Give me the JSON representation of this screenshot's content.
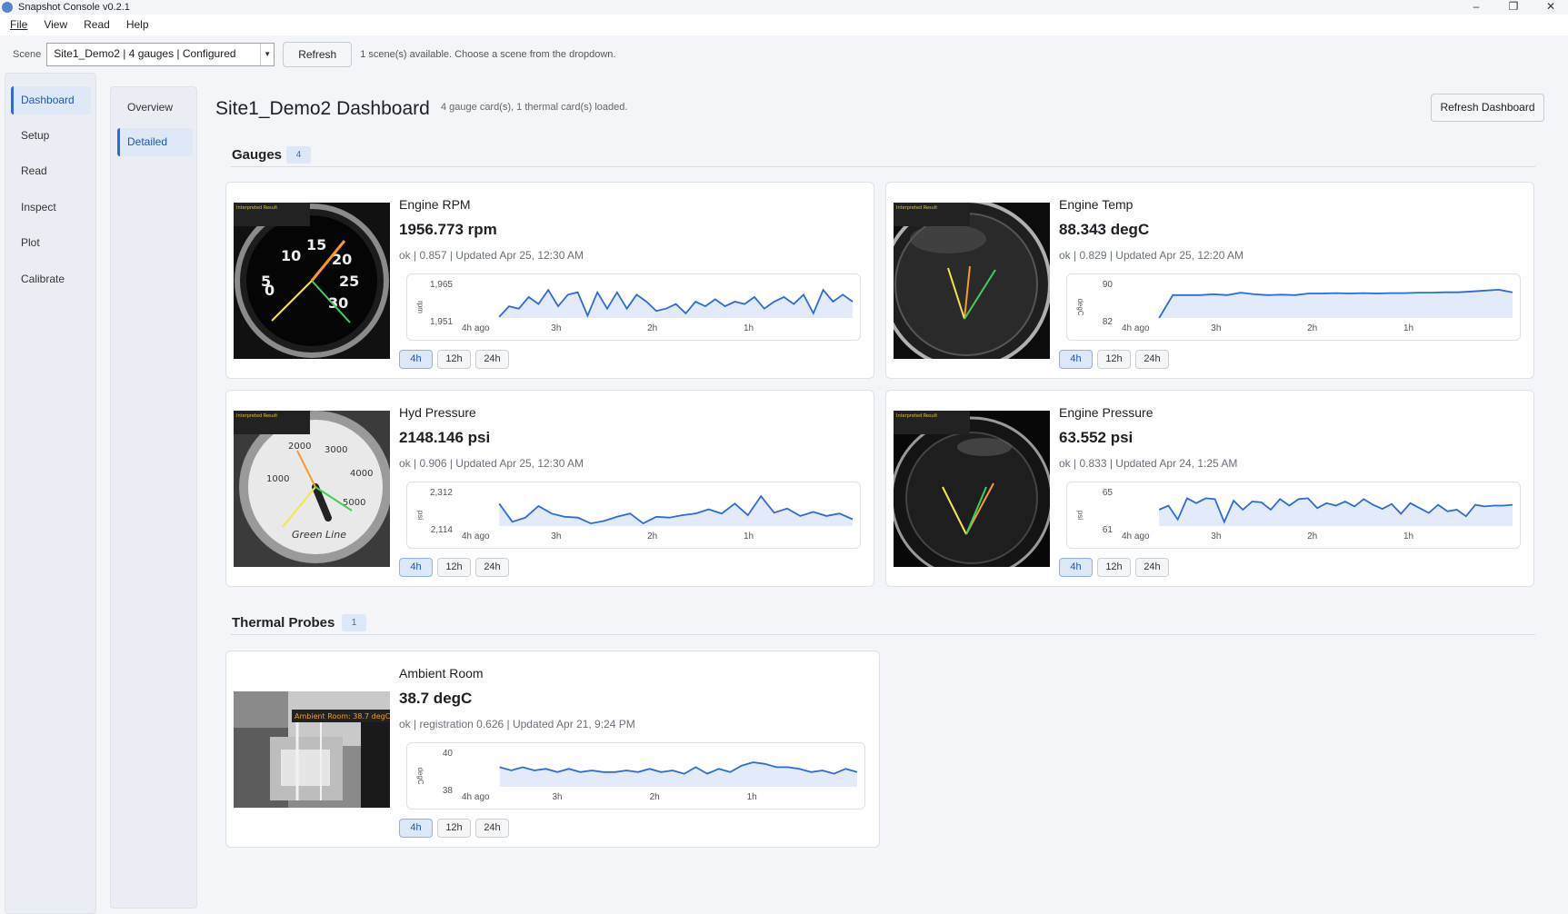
{
  "window": {
    "title": "Snapshot Console v0.2.1",
    "controls": {
      "minimize": "–",
      "maximize": "❐",
      "close": "✕"
    }
  },
  "menu": [
    "File",
    "View",
    "Read",
    "Help"
  ],
  "scene": {
    "label": "Scene",
    "selected": "Site1_Demo2 | 4 gauges | Configured",
    "refresh_label": "Refresh",
    "status": "1 scene(s) available. Choose a scene from the dropdown."
  },
  "nav": {
    "items": [
      "Dashboard",
      "Setup",
      "Read",
      "Inspect",
      "Plot",
      "Calibrate"
    ],
    "active": "Dashboard"
  },
  "subnav": {
    "items": [
      "Overview",
      "Detailed"
    ],
    "active": "Detailed"
  },
  "header": {
    "title": "Site1_Demo2 Dashboard",
    "subtitle": "4 gauge card(s), 1 thermal card(s) loaded.",
    "refresh_label": "Refresh Dashboard"
  },
  "sections": {
    "gauges": {
      "title": "Gauges",
      "count": "4"
    },
    "thermal": {
      "title": "Thermal Probes",
      "count": "1"
    }
  },
  "colors": {
    "accent": "#2f6bd6",
    "spark_fill": "#e3ebfa",
    "needle_orange": "#f39c2b",
    "needle_green": "#3fd15a",
    "needle_yellow": "#f5e54b"
  },
  "range_options": [
    "4h",
    "12h",
    "24h"
  ],
  "active_range": "4h",
  "cards": [
    {
      "id": "engine-rpm",
      "title": "Engine RPM",
      "value": "1956.773 rpm",
      "meta": "ok | 0.857 | Updated Apr 25, 12:30 AM",
      "thumb": {
        "type": "gauge-dark",
        "dial_labels": [
          "0",
          "5",
          "10",
          "15",
          "20",
          "25",
          "30"
        ],
        "caption": "Interpreted Result"
      },
      "chart_data": {
        "type": "line",
        "ylabel": "rpm",
        "y_ticks": [
          "1,965",
          "1,951"
        ],
        "ylim": [
          1951,
          1965
        ],
        "x_ticks": [
          "4h ago",
          "3h",
          "2h",
          "1h"
        ],
        "values": [
          1951.5,
          1956,
          1955,
          1960,
          1957,
          1963,
          1956,
          1961,
          1962,
          1952,
          1962,
          1955,
          1962,
          1955,
          1961,
          1958,
          1954,
          1955,
          1957,
          1953,
          1958,
          1956,
          1959,
          1956,
          1958,
          1957,
          1960,
          1955,
          1958,
          1960,
          1957,
          1961,
          1953,
          1963,
          1958,
          1961,
          1958
        ]
      }
    },
    {
      "id": "engine-temp",
      "title": "Engine Temp",
      "value": "88.343 degC",
      "meta": "ok | 0.829 | Updated Apr 25, 12:20 AM",
      "thumb": {
        "type": "gauge-glass",
        "caption": "Interpreted Result"
      },
      "chart_data": {
        "type": "line",
        "ylabel": "degC",
        "y_ticks": [
          "90",
          "82"
        ],
        "ylim": [
          82,
          90
        ],
        "x_ticks": [
          "4h ago",
          "3h",
          "2h",
          "1h"
        ],
        "values": [
          82,
          87.6,
          87.6,
          87.6,
          87.8,
          87.6,
          88.2,
          87.8,
          87.6,
          87.7,
          87.6,
          88.0,
          88.0,
          88.1,
          88.0,
          88.1,
          88.0,
          88.1,
          88.1,
          88.2,
          88.2,
          88.3,
          88.3,
          88.5,
          88.7,
          88.9,
          88.3
        ]
      }
    },
    {
      "id": "hyd-pressure",
      "title": "Hyd Pressure",
      "value": "2148.146 psi",
      "meta": "ok | 0.906 | Updated Apr 25, 12:30 AM",
      "thumb": {
        "type": "gauge-white",
        "dial_labels": [
          "1000",
          "2000",
          "3000",
          "4000",
          "5000"
        ],
        "brand": "Green Line",
        "caption": "Interpreted Result"
      },
      "chart_data": {
        "type": "line",
        "ylabel": "psi",
        "y_ticks": [
          "2,312",
          "2,114"
        ],
        "ylim": [
          2114,
          2312
        ],
        "x_ticks": [
          "4h ago",
          "3h",
          "2h",
          "1h"
        ],
        "values": [
          2250,
          2140,
          2165,
          2235,
          2190,
          2170,
          2165,
          2130,
          2145,
          2170,
          2190,
          2130,
          2170,
          2165,
          2180,
          2190,
          2215,
          2190,
          2250,
          2180,
          2295,
          2195,
          2220,
          2175,
          2200,
          2175,
          2190,
          2155
        ]
      }
    },
    {
      "id": "engine-pressure",
      "title": "Engine Pressure",
      "value": "63.552 psi",
      "meta": "ok | 0.833 | Updated Apr 24, 1:25 AM",
      "thumb": {
        "type": "gauge-dark-glass",
        "caption": "Interpreted Result"
      },
      "chart_data": {
        "type": "line",
        "ylabel": "psi",
        "y_ticks": [
          "65",
          "61"
        ],
        "ylim": [
          61,
          65
        ],
        "x_ticks": [
          "4h ago",
          "3h",
          "2h",
          "1h"
        ],
        "values": [
          63.0,
          63.5,
          61.8,
          64.4,
          63.8,
          64.4,
          64.3,
          61.5,
          64.1,
          63.0,
          64.0,
          63.9,
          63.0,
          64.3,
          63.5,
          64.3,
          64.4,
          63.2,
          63.8,
          63.5,
          64.0,
          63.4,
          64.3,
          63.6,
          63.1,
          63.7,
          62.5,
          63.8,
          63.2,
          62.6,
          63.6,
          62.8,
          63.0,
          62.2,
          63.6,
          63.4,
          63.5,
          63.5,
          63.6
        ]
      }
    },
    {
      "id": "ambient-room",
      "title": "Ambient Room",
      "value": "38.7 degC",
      "meta": "ok | registration 0.626 | Updated Apr 21, 9:24 PM",
      "thumb": {
        "type": "thermal",
        "caption": "Ambient Room: 38.7 degC"
      },
      "chart_data": {
        "type": "line",
        "ylabel": "degC",
        "y_ticks": [
          "40",
          "38"
        ],
        "ylim": [
          38,
          40
        ],
        "x_ticks": [
          "4h ago",
          "3h",
          "2h",
          "1h"
        ],
        "values": [
          39.2,
          39.0,
          39.2,
          39.0,
          39.1,
          38.9,
          39.1,
          38.9,
          39.0,
          38.9,
          38.9,
          39.0,
          38.9,
          39.1,
          38.9,
          39.0,
          38.8,
          39.2,
          38.8,
          39.1,
          38.9,
          39.3,
          39.5,
          39.4,
          39.2,
          39.2,
          39.1,
          38.9,
          39.0,
          38.8,
          39.1,
          38.9
        ]
      }
    }
  ]
}
